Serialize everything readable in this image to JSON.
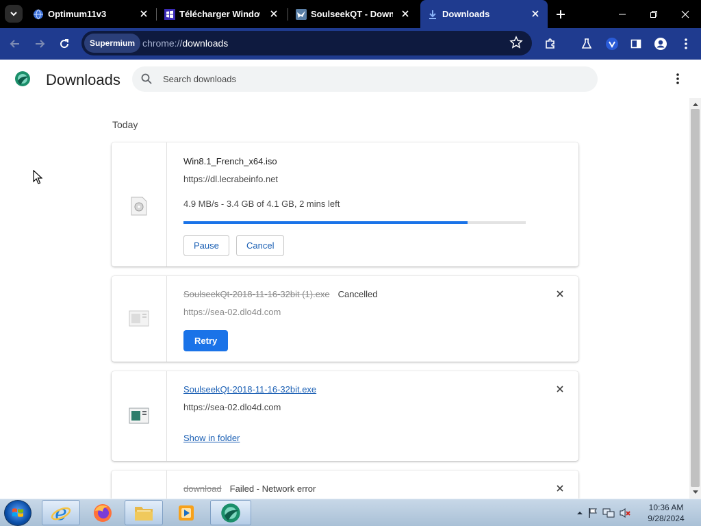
{
  "browser": {
    "tabs": [
      {
        "title": "Optimum11v3",
        "favicon": "globe-icon"
      },
      {
        "title": "Télécharger Windows",
        "favicon": "windows-logo-icon"
      },
      {
        "title": "SoulseekQT - Downlo",
        "favicon": "soulseek-bird-icon"
      },
      {
        "title": "Downloads",
        "favicon": "download-arrow-icon",
        "active": true
      }
    ],
    "address": {
      "chip": "Supermium",
      "scheme": "chrome://",
      "path": "downloads"
    }
  },
  "page": {
    "title": "Downloads",
    "search": {
      "placeholder": "Search downloads",
      "value": ""
    },
    "section": "Today",
    "downloads": [
      {
        "filename": "Win8.1_French_x64.iso",
        "url": "https://dl.lecrabeinfo.net",
        "progress_text": "4.9 MB/s - 3.4 GB of 4.1 GB, 2 mins left",
        "progress": 0.83,
        "actions": {
          "pause": "Pause",
          "cancel": "Cancel"
        }
      },
      {
        "filename": "SoulseekQt-2018-11-16-32bit (1).exe",
        "status": "Cancelled",
        "url": "https://sea-02.dlo4d.com",
        "action": "Retry"
      },
      {
        "filename": "SoulseekQt-2018-11-16-32bit.exe",
        "url": "https://sea-02.dlo4d.com",
        "action": "Show in folder"
      },
      {
        "filename": "download",
        "status": "Failed - Network error"
      }
    ]
  },
  "taskbar": {
    "apps": [
      "internet-explorer-icon",
      "firefox-icon",
      "file-explorer-icon",
      "media-player-icon",
      "supermium-icon"
    ],
    "time": "10:36 AM",
    "date": "9/28/2024"
  },
  "colors": {
    "toolbar": "#1f3b8f",
    "accent": "#1a73e8",
    "link": "#1a5fb4"
  }
}
